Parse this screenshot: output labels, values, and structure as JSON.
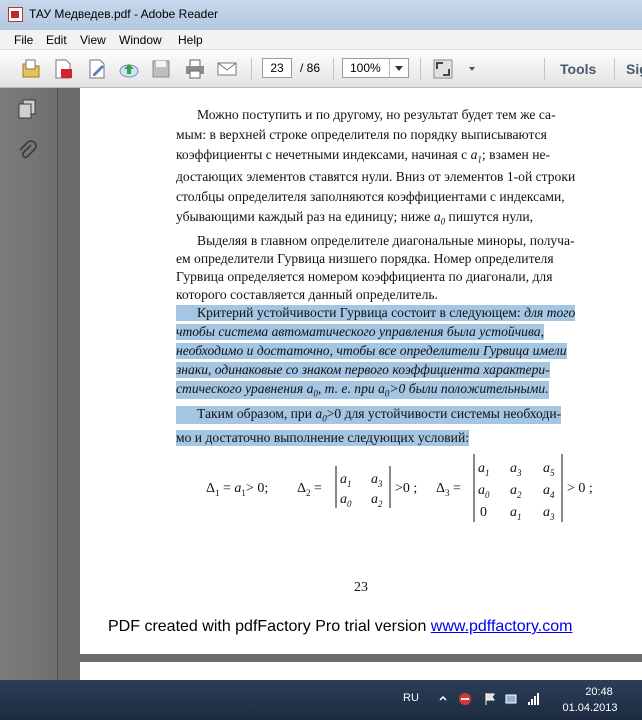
{
  "window": {
    "title": "ТАУ Медведев.pdf - Adobe Reader"
  },
  "menu": [
    "File",
    "Edit",
    "View",
    "Window",
    "Help"
  ],
  "toolbar": {
    "page_current": "23",
    "page_total": "/ 86",
    "zoom": "100%",
    "tools_label": "Tools",
    "sign_label": "Sign"
  },
  "icons": {
    "toolbar": [
      "open-icon",
      "create-pdf-icon",
      "edit-icon",
      "upload-icon",
      "save-icon",
      "print-icon",
      "email-icon",
      "fullscreen-icon",
      "customize-chevron-icon"
    ],
    "panel": [
      "pages-icon",
      "attachments-icon"
    ]
  },
  "colors": {
    "highlight": "#a4c6e2",
    "titlebar": "#b9cce3",
    "taskbar": "#22344c"
  },
  "doc": {
    "p1": [
      "Можно поступить и по другому, но результат будет тем же са-",
      "мым: в верхней строке определителя по порядку выписываются",
      "коэффициенты с нечетными индексами, начиная с",
      "; взамен не-",
      "достающих элементов ставятся нули. Вниз от элементов 1-ой строки",
      "столбцы определителя заполняются коэффициентами с индексами,",
      "убывающими каждый раз на единицу; ниже",
      "пишутся нули,"
    ],
    "p2": [
      "Выделяя в главном определителе диагональные миноры, получа-",
      "ем определители Гурвица низшего порядка. Номер определителя",
      "Гурвица определяется номером коэффициента по диагонали, для",
      "которого составляется данный определитель."
    ],
    "p3": [
      "Критерий устойчивости Гурвица состоит в следующем:",
      "для того",
      "чтобы система  автоматического управления была устойчива,",
      "необходимо и достаточно, чтобы все определители Гурвица имели",
      "знаки, одинаковые со знаком первого коэффициента характери-",
      "стического уравнения",
      ", т. е. при",
      ">0 были положительными."
    ],
    "p4": [
      "Таким образом, при",
      ">0 для устойчивости системы необходи-",
      "мо и достаточно выполнение следующих условий:"
    ],
    "page_number": "23"
  },
  "watermark": {
    "text": "PDF created with pdfFactory Pro trial version ",
    "link": "www.pdffactory.com"
  },
  "taskbar": {
    "lang": "RU",
    "time": "20:48",
    "date": "01.04.2013"
  }
}
